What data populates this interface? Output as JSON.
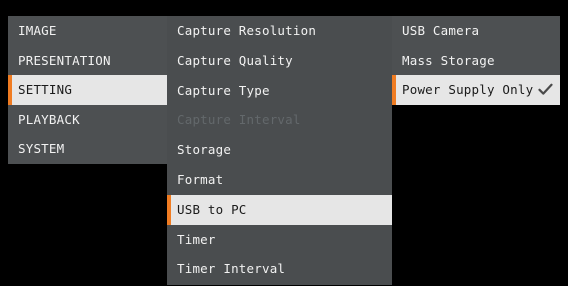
{
  "main_menu": {
    "items": [
      {
        "label": "IMAGE",
        "selected": false
      },
      {
        "label": "PRESENTATION",
        "selected": false
      },
      {
        "label": "SETTING",
        "selected": true
      },
      {
        "label": "PLAYBACK",
        "selected": false
      },
      {
        "label": "SYSTEM",
        "selected": false
      }
    ]
  },
  "setting_menu": {
    "items": [
      {
        "label": "Capture Resolution",
        "selected": false,
        "enabled": true
      },
      {
        "label": "Capture Quality",
        "selected": false,
        "enabled": true
      },
      {
        "label": "Capture Type",
        "selected": false,
        "enabled": true
      },
      {
        "label": "Capture Interval",
        "selected": false,
        "enabled": false
      },
      {
        "label": "Storage",
        "selected": false,
        "enabled": true
      },
      {
        "label": "Format",
        "selected": false,
        "enabled": true
      },
      {
        "label": "USB to PC",
        "selected": true,
        "enabled": true
      },
      {
        "label": "Timer",
        "selected": false,
        "enabled": true
      },
      {
        "label": "Timer Interval",
        "selected": false,
        "enabled": true
      }
    ]
  },
  "usb_options": {
    "items": [
      {
        "label": "USB Camera",
        "selected": false,
        "checked": false
      },
      {
        "label": "Mass Storage",
        "selected": false,
        "checked": false
      },
      {
        "label": "Power Supply Only",
        "selected": true,
        "checked": true,
        "icon": "checkmark-icon"
      }
    ]
  },
  "colors": {
    "accent": "#f07c22",
    "menu_background": "#4d5052",
    "selected_background": "#e6e6e6",
    "disabled_text": "#63686b"
  }
}
